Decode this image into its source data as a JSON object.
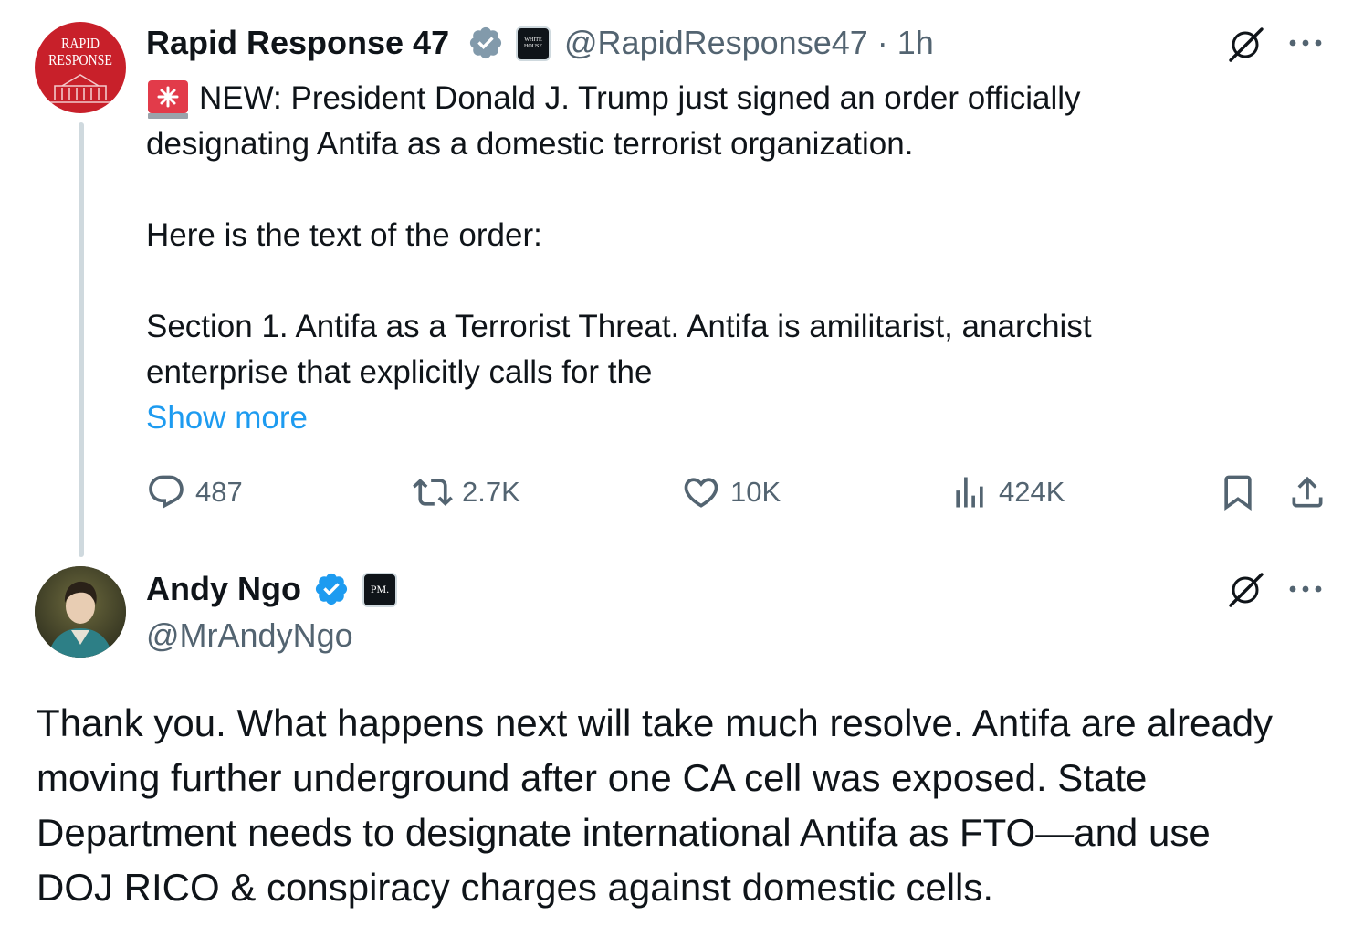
{
  "tweet1": {
    "author_name": "Rapid Response 47",
    "handle": "@RapidResponse47",
    "time": "· 1h",
    "avatar_text_line1": "RAPID",
    "avatar_text_line2": "RESPONSE",
    "affiliate_badge_text": "WHITE HOUSE",
    "lines": [
      "NEW: President Donald J. Trump just signed an order officially",
      "designating Antifa as a domestic terrorist organization.",
      "Here is the text of the order:",
      "Section 1. Antifa as a Terrorist Threat.  Antifa is amilitarist, anarchist",
      "enterprise that explicitly calls for the"
    ],
    "show_more": "Show more",
    "stats": {
      "replies": "487",
      "reposts": "2.7K",
      "likes": "10K",
      "views": "424K"
    }
  },
  "tweet2": {
    "author_name": "Andy Ngo",
    "handle": "@MrAndyNgo",
    "affiliate_badge_text": "PM.",
    "lines": [
      "Thank you. What happens next will take much resolve. Antifa are already",
      "moving further underground after one CA cell was exposed. State",
      "Department needs to designate international Antifa as FTO—and use",
      "DOJ RICO & conspiracy charges against domestic cells."
    ]
  },
  "colors": {
    "verified_blue": "#1d9bf0",
    "verified_gray": "#829aab",
    "link_blue": "#1d9bf0",
    "secondary_text": "#536471",
    "rr_red": "#c8202a"
  },
  "icons": [
    "siren-emoji",
    "grok-icon",
    "more-icon",
    "reply-icon",
    "repost-icon",
    "like-icon",
    "views-icon",
    "bookmark-icon",
    "share-icon",
    "verified-badge-icon"
  ]
}
